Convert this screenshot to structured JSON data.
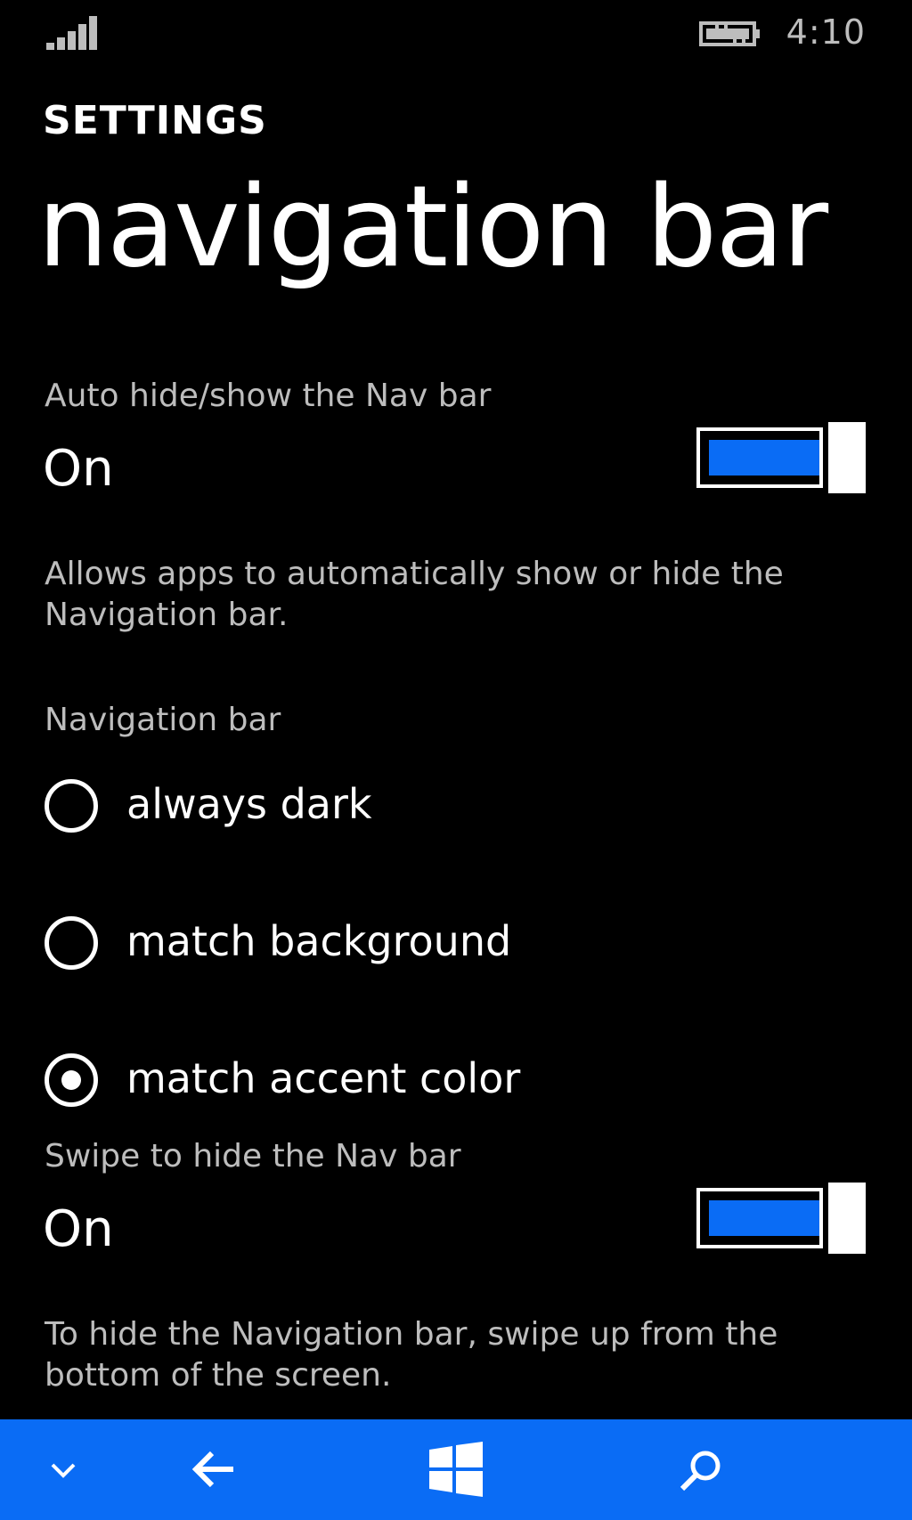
{
  "status_bar": {
    "time": "4:10",
    "signal_icon": "signal-strength-icon",
    "battery_icon": "battery-charging-icon"
  },
  "header": {
    "app_title": "SETTINGS",
    "page_title": "navigation bar"
  },
  "auto_hide": {
    "label": "Auto hide/show the Nav bar",
    "state": "On",
    "enabled": true,
    "description": "Allows apps to automatically show or hide the Navigation bar."
  },
  "nav_color": {
    "label": "Navigation bar",
    "options": [
      {
        "label": "always dark",
        "selected": false
      },
      {
        "label": "match background",
        "selected": false
      },
      {
        "label": "match accent color",
        "selected": true
      }
    ]
  },
  "swipe_hide": {
    "label": "Swipe to hide the Nav bar",
    "state": "On",
    "enabled": true,
    "description": "To hide the Navigation bar, swipe up from the bottom of the screen."
  },
  "nav_bar": {
    "buttons": [
      "chevron-down-icon",
      "back-arrow-icon",
      "windows-logo-icon",
      "search-icon"
    ]
  },
  "colors": {
    "background": "#000000",
    "accent": "#0a6cf5",
    "secondary_text": "#bdbdbd",
    "primary_text": "#ffffff"
  }
}
